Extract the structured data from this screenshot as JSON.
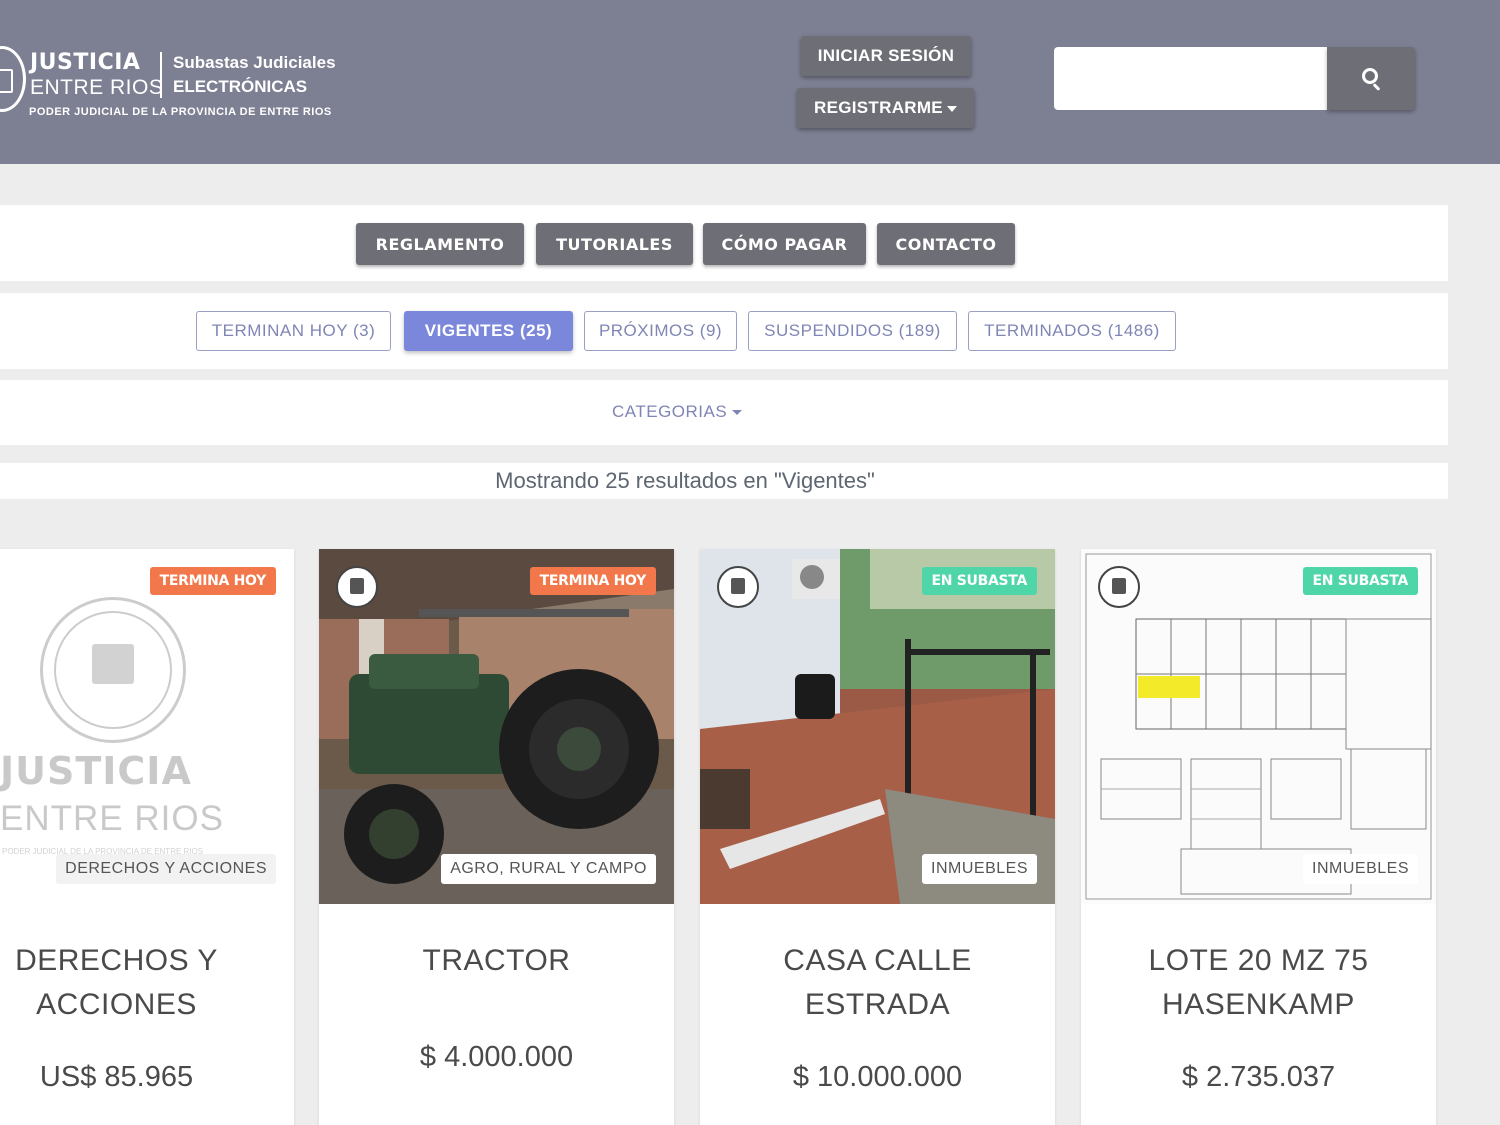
{
  "header": {
    "logo": {
      "line1": "JUSTICIA",
      "line2": "ENTRE RIOS",
      "line3": "Subastas Judiciales",
      "line4": "ELECTRÓNICAS",
      "line5": "PODER JUDICIAL DE LA PROVINCIA DE ENTRE RIOS"
    },
    "login_label": "INICIAR SESIÓN",
    "register_label": "REGISTRARME",
    "search": {
      "value": "",
      "placeholder": ""
    }
  },
  "nav": [
    "REGLAMENTO",
    "TUTORIALES",
    "CÓMO PAGAR",
    "CONTACTO"
  ],
  "filters": [
    {
      "label": "TERMINAN HOY (3)",
      "active": false
    },
    {
      "label": "VIGENTES (25)",
      "active": true
    },
    {
      "label": "PRÓXIMOS (9)",
      "active": false
    },
    {
      "label": "SUSPENDIDOS (189)",
      "active": false
    },
    {
      "label": "TERMINADOS (1486)",
      "active": false
    }
  ],
  "categories_label": "CATEGORIAS",
  "results_text": "Mostrando 25 resultados en \"Vigentes\"",
  "colors": {
    "header_bg": "#7d7f93",
    "button_bg": "#6e6f76",
    "filter_active": "#7b87db",
    "badge_termina_hoy": "#f2784b",
    "badge_en_subasta": "#4fd6a8"
  },
  "cards": [
    {
      "badge": "TERMINA HOY",
      "category": "DERECHOS Y ACCIONES",
      "title": "DERECHOS Y ACCIONES",
      "price": "US$ 85.965",
      "image_text": {
        "line1": "JUSTICIA",
        "line2": "ENTRE RIOS",
        "line3": "PODER JUDICIAL DE LA PROVINCIA DE ENTRE RIOS"
      }
    },
    {
      "badge": "TERMINA HOY",
      "category": "AGRO, RURAL Y CAMPO",
      "title": "TRACTOR",
      "price": "$ 4.000.000"
    },
    {
      "badge": "EN SUBASTA",
      "category": "INMUEBLES",
      "title": "CASA CALLE ESTRADA",
      "price": "$ 10.000.000"
    },
    {
      "badge": "EN SUBASTA",
      "category": "INMUEBLES",
      "title": "LOTE 20 MZ 75 HASENKAMP",
      "price": "$ 2.735.037"
    }
  ]
}
